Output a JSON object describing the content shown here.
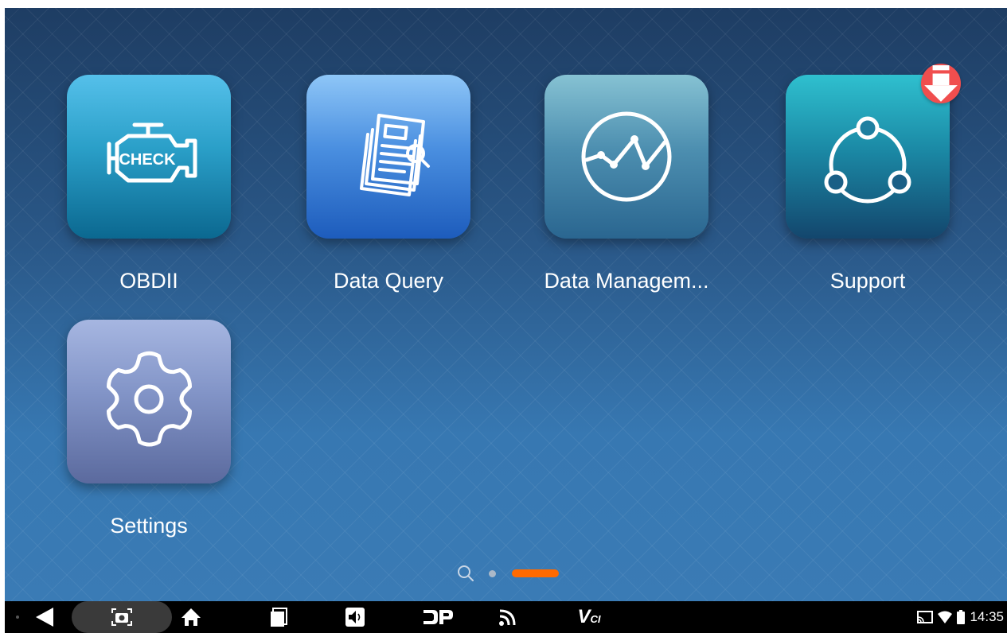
{
  "apps": [
    {
      "label": "OBDII",
      "icon": "check-engine-icon"
    },
    {
      "label": "Data Query",
      "icon": "document-search-icon"
    },
    {
      "label": "Data Managem...",
      "icon": "line-graph-icon"
    },
    {
      "label": "Support",
      "icon": "share-network-icon",
      "badge_icon": "download-arrow-icon"
    },
    {
      "label": "Settings",
      "icon": "gear-icon"
    }
  ],
  "obd_icon_text": "CHECK",
  "pager": {
    "search": "search-icon",
    "pages": 2,
    "active_page": 2,
    "active_color": "#ff6a00"
  },
  "navbar": {
    "buttons": [
      "back-icon",
      "screenshot-icon",
      "home-icon",
      "recents-icon",
      "volume-icon",
      "dp-icon",
      "rss-icon",
      "vci-icon"
    ],
    "vci_text": "V",
    "vci_sub": "CI",
    "time": "14:35"
  },
  "colors": {
    "badge": "#f04e4e",
    "active_dot": "#ff6a00",
    "background": "#2a5888"
  }
}
